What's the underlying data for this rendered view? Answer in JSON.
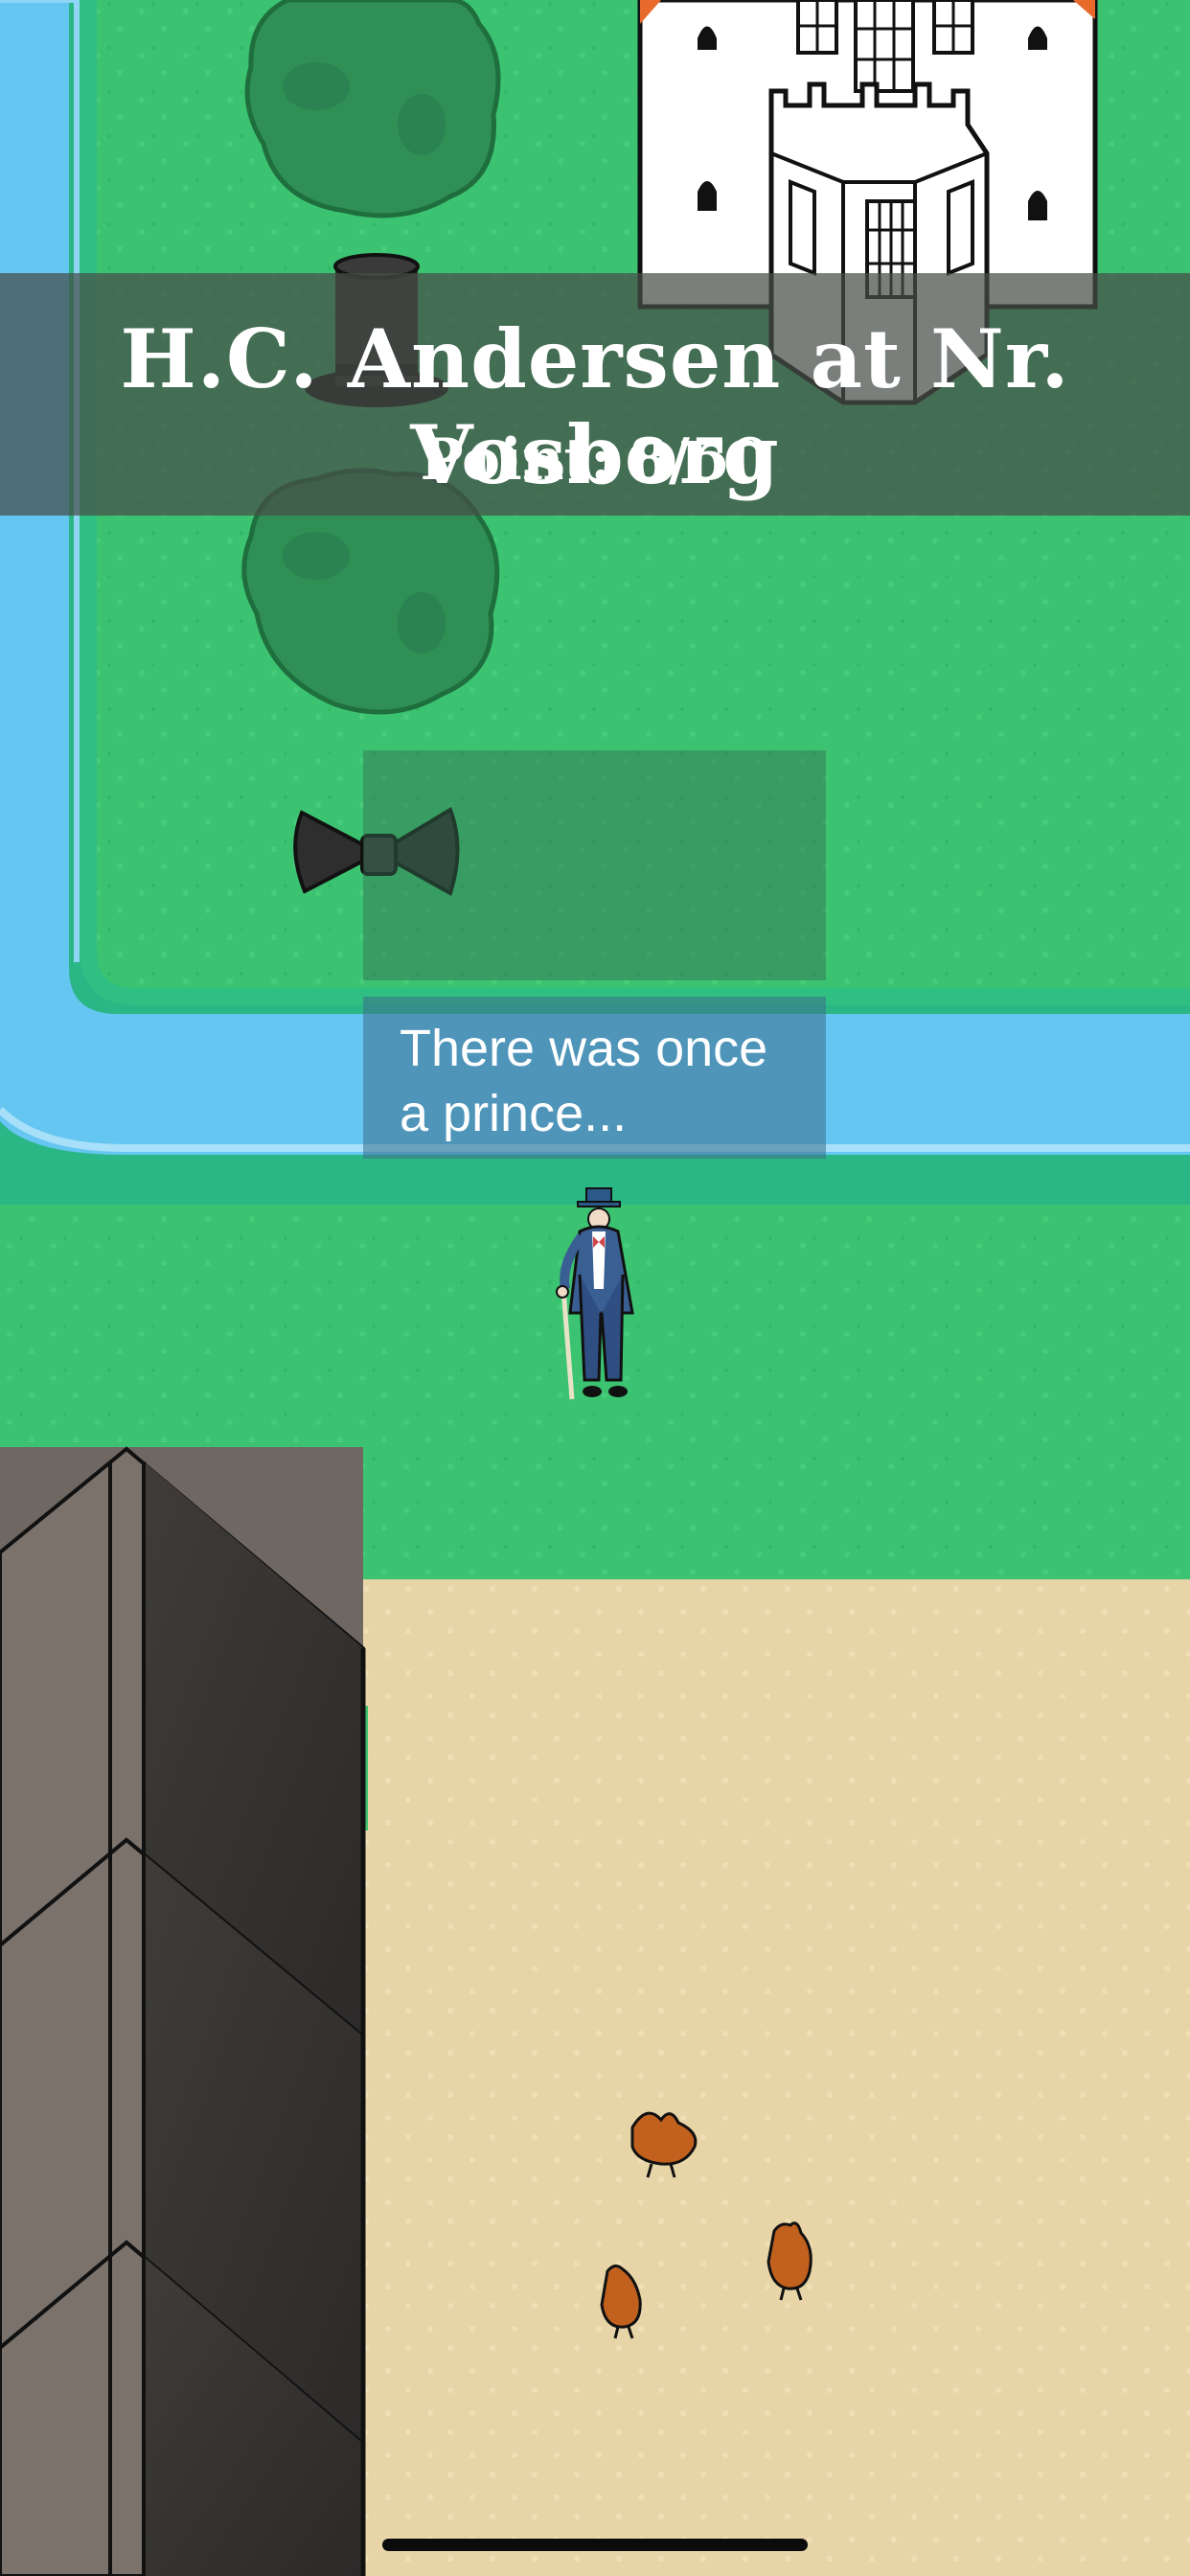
{
  "game": {
    "title": "H.C. Andersen at Nr. Vosborg",
    "score_label": "Point:",
    "score_value": "8/50",
    "score_current": 8,
    "score_max": 50
  },
  "dialog": {
    "line1": "There was once",
    "line2": "a prince..."
  },
  "scene": {
    "items": [
      "top-hat",
      "bow-tie"
    ],
    "characters": [
      "hc-andersen-player",
      "chicken",
      "chicken",
      "chicken"
    ],
    "terrain": [
      "grass",
      "moat-water",
      "sand-yard",
      "farm-building-roof",
      "castle",
      "bush"
    ]
  },
  "colors": {
    "grass": "#3cc371",
    "moat": "#66c6f2",
    "sand": "#e8d5a7",
    "roof_dark": "#4a4643",
    "hud_bg": "#464e48"
  }
}
